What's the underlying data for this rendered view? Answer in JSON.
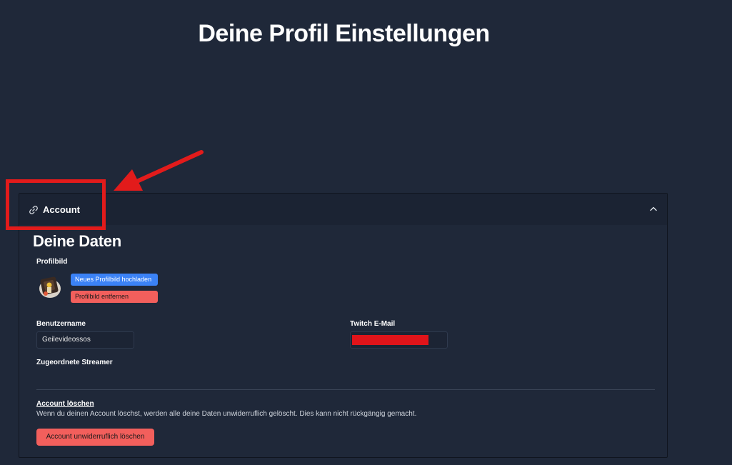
{
  "page": {
    "title": "Deine Profil Einstellungen"
  },
  "account_panel": {
    "header_label": "Account",
    "header_icon": "link-icon",
    "collapse_icon": "chevron-up-icon",
    "section_title": "Deine Daten",
    "profile_picture": {
      "label": "Profilbild",
      "upload_label": "Neues Profilbild hochladen",
      "remove_label": "Profilbild entfernen"
    },
    "username": {
      "label": "Benutzername",
      "value": "Geilevideossos"
    },
    "twitch_email": {
      "label": "Twitch E-Mail",
      "value_redacted": true
    },
    "streamers": {
      "label": "Zugeordnete Streamer"
    },
    "delete_account": {
      "title": "Account löschen",
      "description": "Wenn du deinen Account löschst, werden alle deine Daten unwiderruflich gelöscht. Dies kann nicht rückgängig gemacht.",
      "button_label": "Account unwiderruflich löschen"
    }
  },
  "colors": {
    "background": "#1f2839",
    "header_background": "#1b2333",
    "primary_button": "#3b82f6",
    "danger_button": "#f25f5c",
    "annotation": "#e21b1b"
  }
}
